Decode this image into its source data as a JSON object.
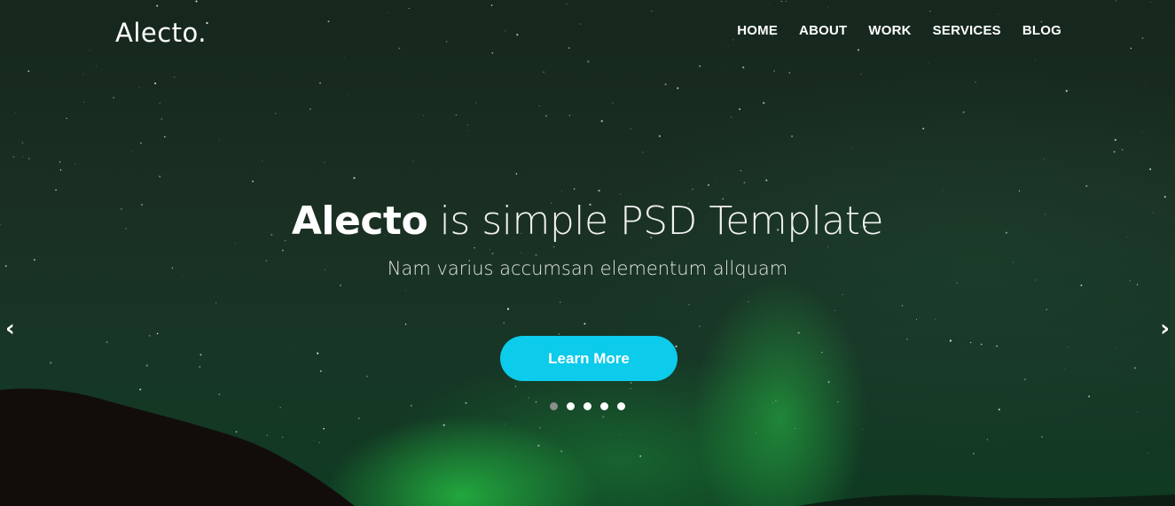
{
  "brand": {
    "logo": "Alecto."
  },
  "nav": {
    "items": [
      {
        "label": "HOME"
      },
      {
        "label": "ABOUT"
      },
      {
        "label": "WORK"
      },
      {
        "label": "SERVICES"
      },
      {
        "label": "BLOG"
      }
    ]
  },
  "hero": {
    "title_strong": "Alecto",
    "title_rest": " is simple PSD Template",
    "subtitle": "Nam varius accumsan elementum allquam",
    "cta_label": "Learn More",
    "cta_color": "#0ccbeb"
  },
  "carousel": {
    "prev_icon": "‹",
    "next_icon": "›",
    "slide_count": 5,
    "active_index": 0
  }
}
